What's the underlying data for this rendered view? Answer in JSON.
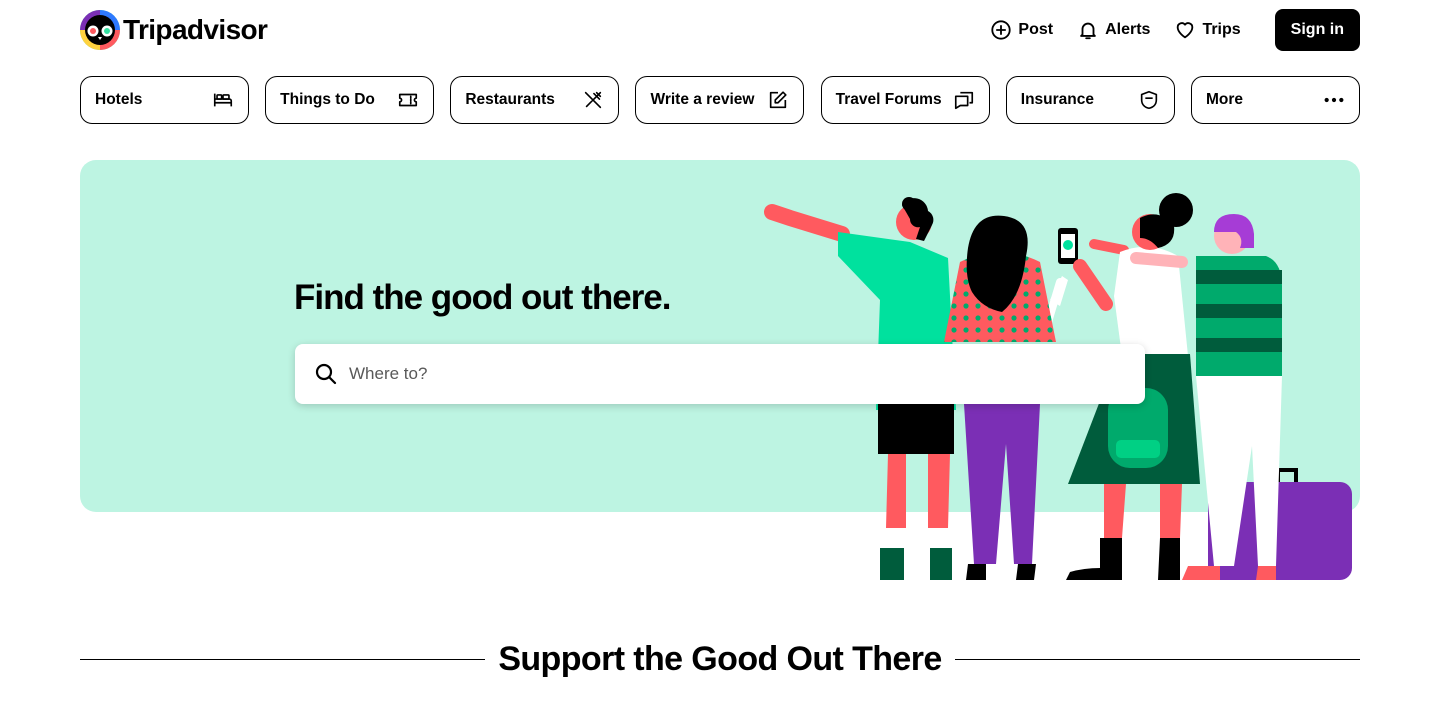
{
  "brand": {
    "name": "Tripadvisor",
    "logo_icon": "owl-logo-icon"
  },
  "header": {
    "links": [
      {
        "label": "Post",
        "icon": "plus-circle-icon"
      },
      {
        "label": "Alerts",
        "icon": "bell-icon"
      },
      {
        "label": "Trips",
        "icon": "heart-icon"
      }
    ],
    "signin_label": "Sign in"
  },
  "categories": [
    {
      "label": "Hotels",
      "icon": "bed-icon"
    },
    {
      "label": "Things to Do",
      "icon": "ticket-icon"
    },
    {
      "label": "Restaurants",
      "icon": "utensils-icon"
    },
    {
      "label": "Write a review",
      "icon": "edit-icon"
    },
    {
      "label": "Travel Forums",
      "icon": "chat-bubbles-icon"
    },
    {
      "label": "Insurance",
      "icon": "shield-icon"
    },
    {
      "label": "More",
      "icon": "more-dots-icon"
    }
  ],
  "hero": {
    "title": "Find the good out there.",
    "search_placeholder": "Where to?",
    "search_value": ""
  },
  "section": {
    "title": "Support the Good Out There"
  },
  "colors": {
    "hero_bg": "#bdf4e2",
    "brand_green": "#00aa6c",
    "coral": "#ff5a5f",
    "purple": "#7b2fb5",
    "dark_green": "#005c3c"
  }
}
